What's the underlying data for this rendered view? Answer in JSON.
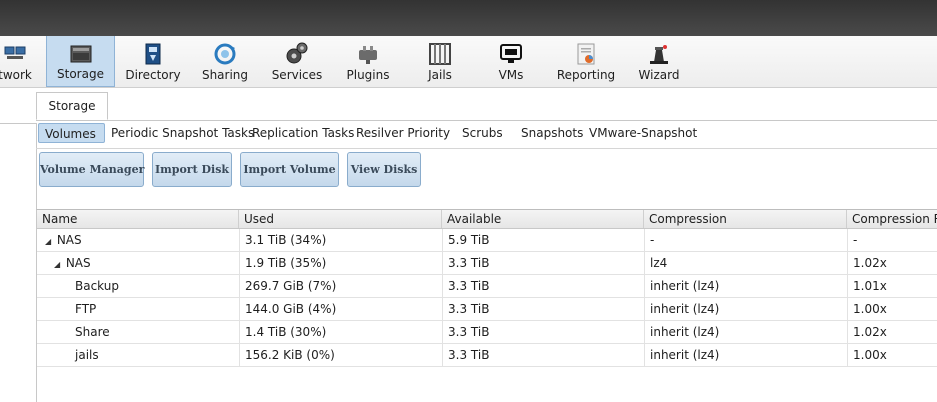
{
  "toolbar": {
    "items": [
      {
        "label": "twork",
        "icon": "network-icon"
      },
      {
        "label": "Storage",
        "icon": "storage-icon",
        "active": true
      },
      {
        "label": "Directory",
        "icon": "directory-icon"
      },
      {
        "label": "Sharing",
        "icon": "sharing-icon"
      },
      {
        "label": "Services",
        "icon": "services-icon"
      },
      {
        "label": "Plugins",
        "icon": "plugins-icon"
      },
      {
        "label": "Jails",
        "icon": "jails-icon"
      },
      {
        "label": "VMs",
        "icon": "vms-icon"
      },
      {
        "label": "Reporting",
        "icon": "reporting-icon"
      },
      {
        "label": "Wizard",
        "icon": "wizard-icon"
      }
    ]
  },
  "main_tab": "Storage",
  "subtabs": [
    "Volumes",
    "Periodic Snapshot Tasks",
    "Replication Tasks",
    "Resilver Priority",
    "Scrubs",
    "Snapshots",
    "VMware-Snapshot"
  ],
  "buttons": [
    "Volume Manager",
    "Import Disk",
    "Import Volume",
    "View Disks"
  ],
  "table": {
    "columns": [
      "Name",
      "Used",
      "Available",
      "Compression",
      "Compression Ra"
    ],
    "rows": [
      {
        "name": "NAS",
        "used": "3.1 TiB (34%)",
        "available": "5.9 TiB",
        "compression": "-",
        "ratio": "-"
      },
      {
        "name": "NAS",
        "used": "1.9 TiB (35%)",
        "available": "3.3 TiB",
        "compression": "lz4",
        "ratio": "1.02x"
      },
      {
        "name": "Backup",
        "used": "269.7 GiB (7%)",
        "available": "3.3 TiB",
        "compression": "inherit (lz4)",
        "ratio": "1.01x"
      },
      {
        "name": "FTP",
        "used": "144.0 GiB (4%)",
        "available": "3.3 TiB",
        "compression": "inherit (lz4)",
        "ratio": "1.00x"
      },
      {
        "name": "Share",
        "used": "1.4 TiB (30%)",
        "available": "3.3 TiB",
        "compression": "inherit (lz4)",
        "ratio": "1.02x"
      },
      {
        "name": "jails",
        "used": "156.2 KiB (0%)",
        "available": "3.3 TiB",
        "compression": "inherit (lz4)",
        "ratio": "1.00x"
      }
    ]
  }
}
